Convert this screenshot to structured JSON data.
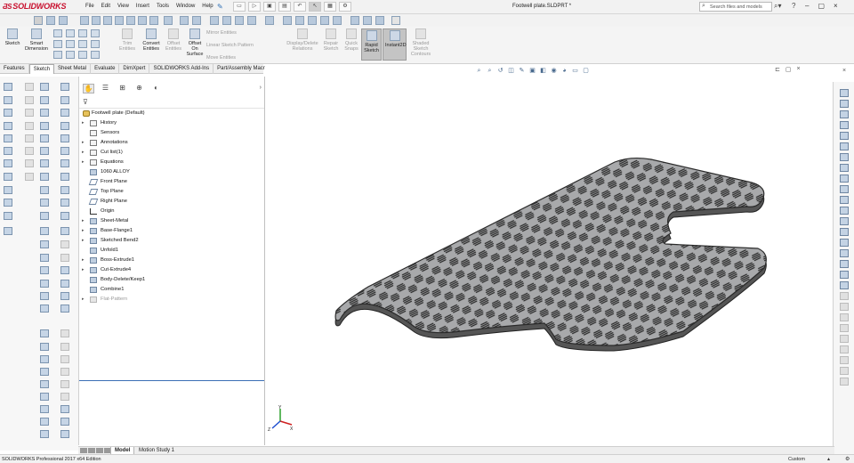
{
  "app": {
    "brand": "SOLIDWORKS",
    "document_title": "Footwell plate.SLDPRT *"
  },
  "menu": [
    "File",
    "Edit",
    "View",
    "Insert",
    "Tools",
    "Window",
    "Help"
  ],
  "search": {
    "placeholder": "Search files and models"
  },
  "window_controls": [
    "–",
    "▢",
    "×"
  ],
  "command_manager": {
    "sketch": "Sketch",
    "smart_dimension": "Smart Dimension",
    "trim_entities": "Trim Entities",
    "convert_entities": "Convert Entities",
    "offset_entities": "Offset Entities",
    "offset_on_surface": "Offset On Surface",
    "mirror_entities": "Mirror Entities",
    "linear_sketch_pattern": "Linear Sketch Pattern",
    "move_entities": "Move Entities",
    "display_delete_relations": "Display/Delete Relations",
    "repair_sketch": "Repair Sketch",
    "quick_snaps": "Quick Snaps",
    "rapid_sketch": "Rapid Sketch",
    "instant2d": "Instant2D",
    "shaded_sketch_contours": "Shaded Sketch Contours"
  },
  "tabs": [
    "Features",
    "Sketch",
    "Sheet Metal",
    "Evaluate",
    "DimXpert",
    "SOLIDWORKS Add-Ins",
    "Part/Assembly Macros"
  ],
  "active_tab": "Sketch",
  "feature_tree": {
    "root": "Footwell plate  (Default)",
    "items": [
      {
        "label": "History",
        "icon": "history-icon",
        "expandable": true
      },
      {
        "label": "Sensors",
        "icon": "sensors-icon",
        "expandable": false
      },
      {
        "label": "Annotations",
        "icon": "annotations-icon",
        "expandable": true
      },
      {
        "label": "Cut list(1)",
        "icon": "cut-list-icon",
        "expandable": true
      },
      {
        "label": "Equations",
        "icon": "equations-icon",
        "expandable": true
      },
      {
        "label": "1060 ALLOY",
        "icon": "material-icon",
        "expandable": false
      },
      {
        "label": "Front Plane",
        "icon": "plane-icon",
        "expandable": false
      },
      {
        "label": "Top Plane",
        "icon": "plane-icon",
        "expandable": false
      },
      {
        "label": "Right Plane",
        "icon": "plane-icon",
        "expandable": false
      },
      {
        "label": "Origin",
        "icon": "origin-icon",
        "expandable": false
      },
      {
        "label": "Sheet-Metal",
        "icon": "sheet-metal-icon",
        "expandable": true
      },
      {
        "label": "Base-Flange1",
        "icon": "base-flange-icon",
        "expandable": true
      },
      {
        "label": "Sketched Bend2",
        "icon": "sketched-bend-icon",
        "expandable": true
      },
      {
        "label": "Unfold1",
        "icon": "unfold-icon",
        "expandable": false
      },
      {
        "label": "Boss-Extrude1",
        "icon": "boss-extrude-icon",
        "expandable": true
      },
      {
        "label": "Cut-Extrude4",
        "icon": "cut-extrude-icon",
        "expandable": true
      },
      {
        "label": "Body-Delete/Keep1",
        "icon": "body-delete-icon",
        "expandable": false
      },
      {
        "label": "Combine1",
        "icon": "combine-icon",
        "expandable": false
      },
      {
        "label": "Flat-Pattern",
        "icon": "flat-pattern-icon",
        "expandable": true,
        "suppressed": true
      }
    ]
  },
  "bottom_tabs": [
    "Model",
    "Motion Study 1"
  ],
  "status": {
    "left": "SOLIDWORKS Professional 2017 x64 Edition",
    "right": "Custom"
  },
  "triad": {
    "x": "X",
    "y": "Y",
    "z": "Z"
  },
  "colors": {
    "brand_red": "#c8102e",
    "part_face": "#a8a9ab",
    "part_edge": "#2b2b2b",
    "tread_pattern": "#2a2a2a",
    "active_button": "#c4c4c4"
  }
}
